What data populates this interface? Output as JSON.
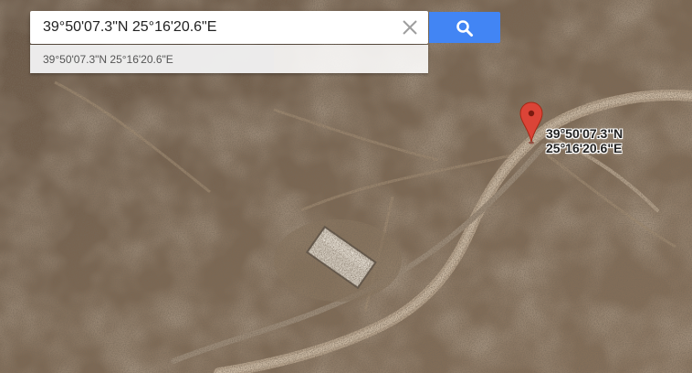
{
  "search": {
    "value": "39°50'07.3\"N 25°16'20.6\"E"
  },
  "suggestions": [
    {
      "text": "39°50'07.3\"N 25°16'20.6\"E"
    }
  ],
  "marker": {
    "label_line1": "39°50'07.3\"N",
    "label_line2": "25°16'20.6\"E"
  },
  "icons": {
    "clear": "close-icon",
    "search": "search-icon",
    "marker": "map-pin-icon"
  },
  "colors": {
    "search_button": "#4285f4",
    "marker": "#db4437"
  }
}
